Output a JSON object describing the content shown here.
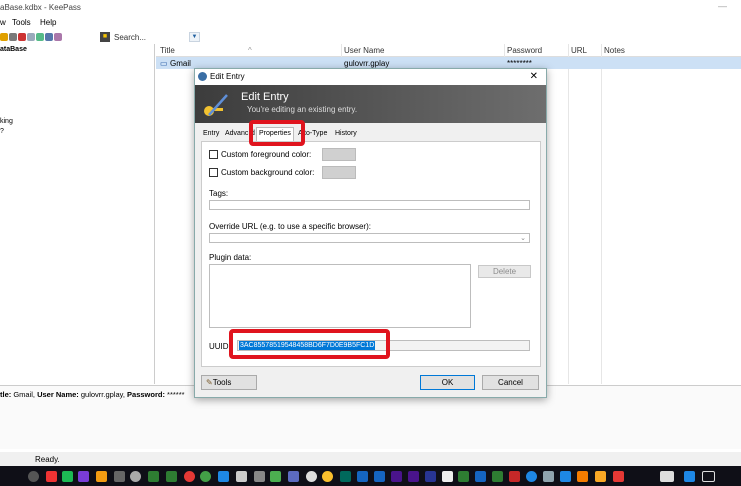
{
  "window": {
    "title": "aBase.kdbx - KeePass"
  },
  "menu": {
    "items": [
      "w",
      "Tools",
      "Help"
    ]
  },
  "toolbar": {
    "search_label": "Search..."
  },
  "tree": {
    "items": [
      "ataBase",
      "king",
      "?"
    ]
  },
  "grid": {
    "columns": [
      "Title",
      "User Name",
      "Password",
      "URL",
      "Notes"
    ],
    "rows": [
      {
        "title": "Gmail",
        "user": "gulovrr.gplay",
        "password": "********",
        "url": "",
        "notes": ""
      }
    ]
  },
  "detail": {
    "title_key": "tle:",
    "title_val": " Gmail, ",
    "user_key": "User Name:",
    "user_val": " gulovrr.gplay, ",
    "pw_key": "Password:",
    "pw_val": " ******"
  },
  "status": {
    "text": "Ready."
  },
  "dialog": {
    "window_title": "Edit Entry",
    "heading": "Edit Entry",
    "subheading": "You're editing an existing entry.",
    "tabs": [
      "Entry",
      "Advanc",
      "d",
      "Properties",
      "A",
      "to-Type",
      "History"
    ],
    "fg_label": "Custom foreground color:",
    "bg_label": "Custom background color:",
    "tags_label": "Tags:",
    "override_label": "Override URL (e.g. to use a specific browser):",
    "plugin_label": "Plugin data:",
    "delete_label": "Delete",
    "uuid_label": "UUID:",
    "uuid_value": "3AC85578519548458BD6F7D0E9B5FC1D",
    "tools_label": "Tools",
    "ok_label": "OK",
    "cancel_label": "Cancel"
  },
  "colors": {
    "highlight": "#e0141e",
    "selection": "#0078d7",
    "row_select": "#cce0f5"
  }
}
